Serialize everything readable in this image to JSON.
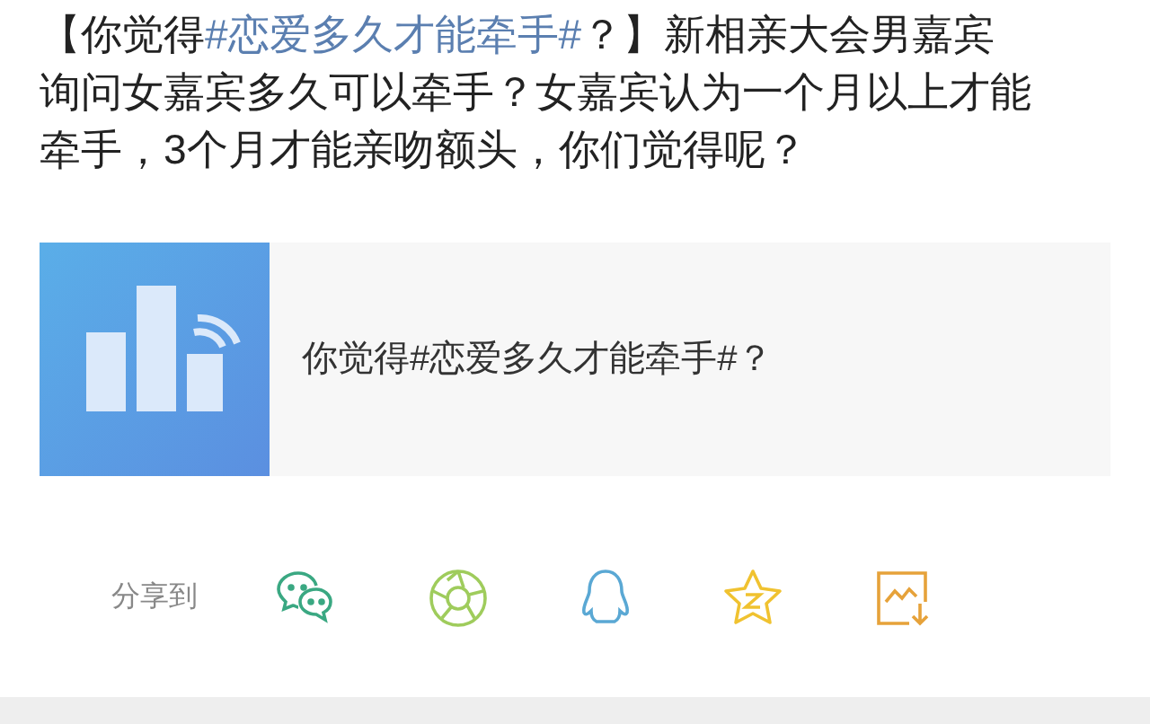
{
  "post": {
    "lines": [
      [
        {
          "kind": "text",
          "text": "【你觉得"
        },
        {
          "kind": "hashtag",
          "text": "#恋爱多久才能牵手#"
        },
        {
          "kind": "text",
          "text": "？】新相亲大会男嘉宾"
        }
      ],
      [
        {
          "kind": "text",
          "text": "询问女嘉宾多久可以牵手？女嘉宾认为一个月以上才能"
        }
      ],
      [
        {
          "kind": "text",
          "text": "牵手，3个月才能亲吻额头，你们觉得呢？"
        }
      ]
    ]
  },
  "card": {
    "title": "你觉得#恋爱多久才能牵手#？"
  },
  "share": {
    "label": "分享到"
  }
}
